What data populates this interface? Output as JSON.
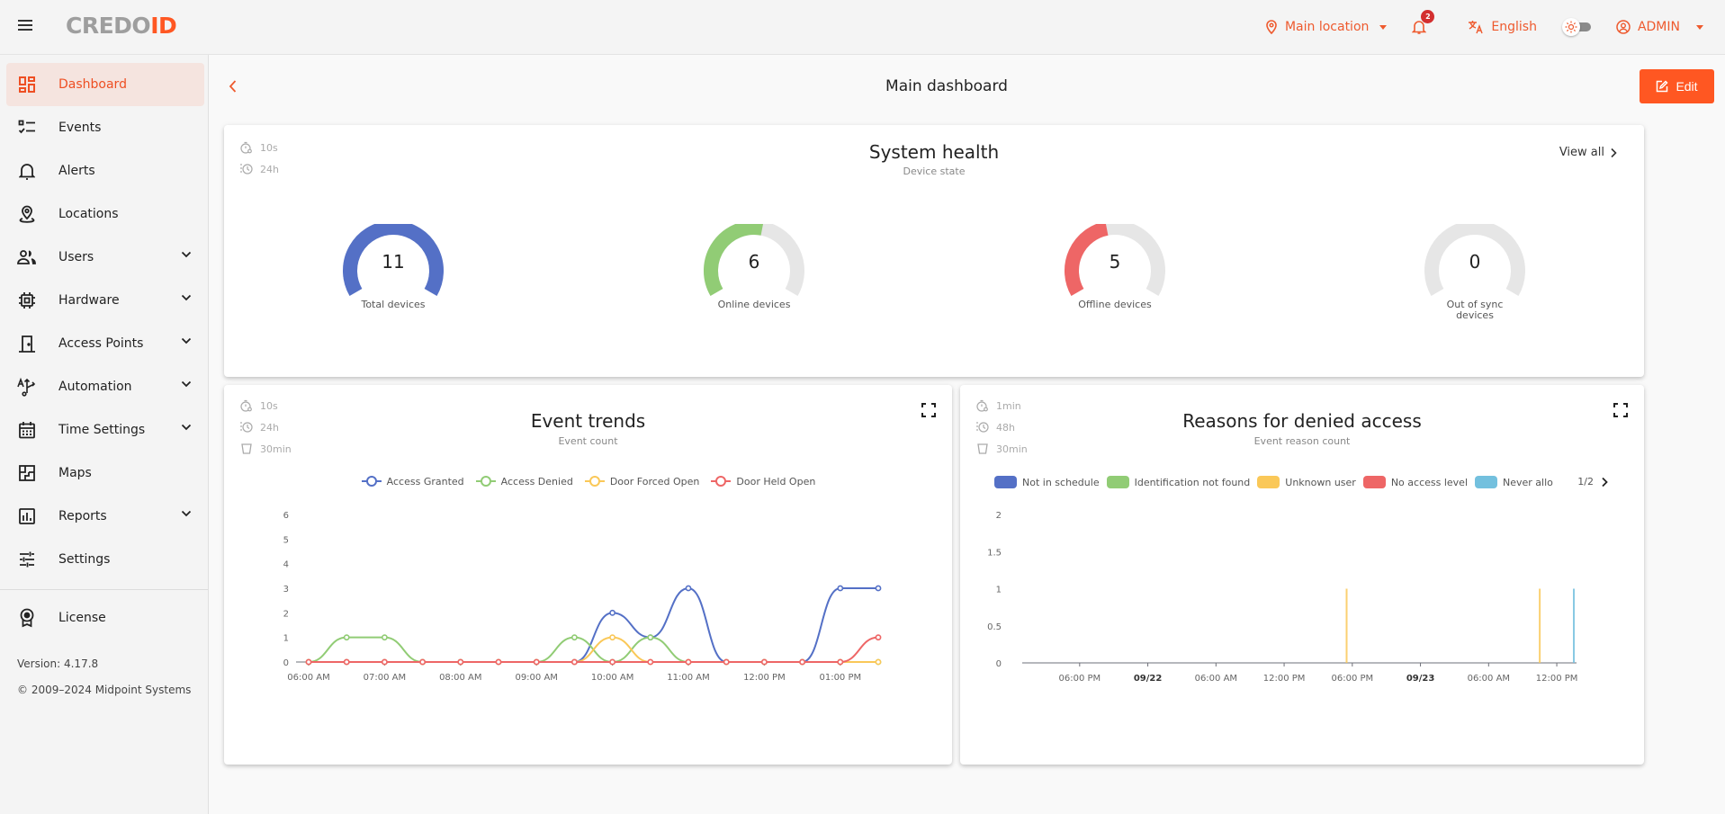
{
  "topbar": {
    "logo_left": "CREDO",
    "logo_right": "ID",
    "location": "Main location",
    "notifications_count": "2",
    "language": "English",
    "user": "ADMIN"
  },
  "sidebar": {
    "items": [
      {
        "label": "Dashboard",
        "icon": "dashboard-icon",
        "active": true,
        "expandable": false
      },
      {
        "label": "Events",
        "icon": "events-checklist-icon",
        "expandable": false
      },
      {
        "label": "Alerts",
        "icon": "bell-icon",
        "expandable": false
      },
      {
        "label": "Locations",
        "icon": "location-pin-icon",
        "expandable": false
      },
      {
        "label": "Users",
        "icon": "users-icon",
        "expandable": true
      },
      {
        "label": "Hardware",
        "icon": "chip-icon",
        "expandable": true
      },
      {
        "label": "Access Points",
        "icon": "door-icon",
        "expandable": true
      },
      {
        "label": "Automation",
        "icon": "automation-icon",
        "expandable": true
      },
      {
        "label": "Time Settings",
        "icon": "calendar-icon",
        "expandable": true
      },
      {
        "label": "Maps",
        "icon": "floorplan-icon",
        "expandable": false
      },
      {
        "label": "Reports",
        "icon": "bar-chart-icon",
        "expandable": true
      },
      {
        "label": "Settings",
        "icon": "sliders-icon",
        "expandable": false
      }
    ],
    "license_label": "License",
    "version": "Version: 4.17.8",
    "copyright": "© 2009–2024 Midpoint Systems"
  },
  "header": {
    "title": "Main dashboard",
    "edit_label": "Edit"
  },
  "colors": {
    "accent": "#ff5722",
    "blue": "#5470c6",
    "green": "#91cc75",
    "yellow": "#fac858",
    "red": "#ee6666",
    "cyan": "#73c0de",
    "gauge_track": "#e6e6e6"
  },
  "system_health": {
    "refresh": "10s",
    "range": "24h",
    "title": "System health",
    "subtitle": "Device state",
    "view_all": "View all",
    "gauges": [
      {
        "label": "Total devices",
        "value": 11,
        "max": 11,
        "color": "#5470c6"
      },
      {
        "label": "Online devices",
        "value": 6,
        "max": 11,
        "color": "#91cc75"
      },
      {
        "label": "Offline devices",
        "value": 5,
        "max": 11,
        "color": "#ee6666"
      },
      {
        "label": "Out of sync devices",
        "value": 0,
        "max": 11,
        "color": "#73c0de"
      }
    ]
  },
  "event_trends": {
    "refresh": "10s",
    "range": "24h",
    "interval": "30min",
    "title": "Event trends",
    "subtitle": "Event count"
  },
  "denied_access": {
    "refresh": "1min",
    "range": "48h",
    "interval": "30min",
    "title": "Reasons for denied access",
    "subtitle": "Event reason count",
    "legend_page": "1/2"
  },
  "chart_data": [
    {
      "type": "line",
      "title": "Event trends",
      "subtitle": "Event count",
      "x": [
        "06:00 AM",
        "06:30 AM",
        "07:00 AM",
        "07:30 AM",
        "08:00 AM",
        "08:30 AM",
        "09:00 AM",
        "09:30 AM",
        "10:00 AM",
        "10:30 AM",
        "11:00 AM",
        "11:30 AM",
        "12:00 PM",
        "12:30 PM",
        "01:00 PM",
        "01:30 PM"
      ],
      "x_tick_labels": [
        "06:00 AM",
        "07:00 AM",
        "08:00 AM",
        "09:00 AM",
        "10:00 AM",
        "11:00 AM",
        "12:00 PM",
        "01:00 PM"
      ],
      "ylim": [
        0,
        6
      ],
      "y_ticks": [
        0,
        1,
        2,
        3,
        4,
        5,
        6
      ],
      "legend": "top-center",
      "grid": false,
      "series": [
        {
          "name": "Access Granted",
          "color": "#5470c6",
          "values": [
            0,
            0,
            0,
            0,
            0,
            0,
            0,
            0,
            2,
            1,
            3,
            0,
            0,
            0,
            3,
            3
          ]
        },
        {
          "name": "Access Denied",
          "color": "#91cc75",
          "values": [
            0,
            1,
            1,
            0,
            0,
            0,
            0,
            1,
            0,
            1,
            0,
            0,
            0,
            0,
            0,
            0
          ]
        },
        {
          "name": "Door Forced Open",
          "color": "#fac858",
          "values": [
            0,
            0,
            0,
            0,
            0,
            0,
            0,
            0,
            1,
            0,
            0,
            0,
            0,
            0,
            0,
            0
          ]
        },
        {
          "name": "Door Held Open",
          "color": "#ee6666",
          "values": [
            0,
            0,
            0,
            0,
            0,
            0,
            0,
            0,
            0,
            0,
            0,
            0,
            0,
            0,
            0,
            1
          ]
        }
      ]
    },
    {
      "type": "bar",
      "title": "Reasons for denied access",
      "subtitle": "Event reason count",
      "x_range_hours": [
        -4.5,
        43.5
      ],
      "x_ticks": [
        {
          "label": "06:00 PM",
          "hour": 0,
          "bold": false
        },
        {
          "label": "09/22",
          "hour": 6,
          "bold": true
        },
        {
          "label": "06:00 AM",
          "hour": 12,
          "bold": false
        },
        {
          "label": "12:00 PM",
          "hour": 18,
          "bold": false
        },
        {
          "label": "06:00 PM",
          "hour": 24,
          "bold": false
        },
        {
          "label": "09/23",
          "hour": 30,
          "bold": true
        },
        {
          "label": "06:00 AM",
          "hour": 36,
          "bold": false
        },
        {
          "label": "12:00 PM",
          "hour": 42,
          "bold": false
        }
      ],
      "ylim": [
        0,
        2
      ],
      "y_ticks": [
        0,
        0.5,
        1,
        1.5,
        2
      ],
      "legend": "top-center",
      "grid": false,
      "series": [
        {
          "name": "Not in schedule",
          "color": "#5470c6",
          "points": []
        },
        {
          "name": "Identification not found",
          "color": "#91cc75",
          "points": []
        },
        {
          "name": "Unknown user",
          "color": "#fac858",
          "points": [
            {
              "hour": 23.5,
              "value": 1
            },
            {
              "hour": 40.5,
              "value": 1
            }
          ]
        },
        {
          "name": "No access level",
          "color": "#ee6666",
          "points": []
        },
        {
          "name": "Never allo",
          "color": "#73c0de",
          "points": [
            {
              "hour": 43.5,
              "value": 1
            }
          ]
        }
      ]
    }
  ]
}
